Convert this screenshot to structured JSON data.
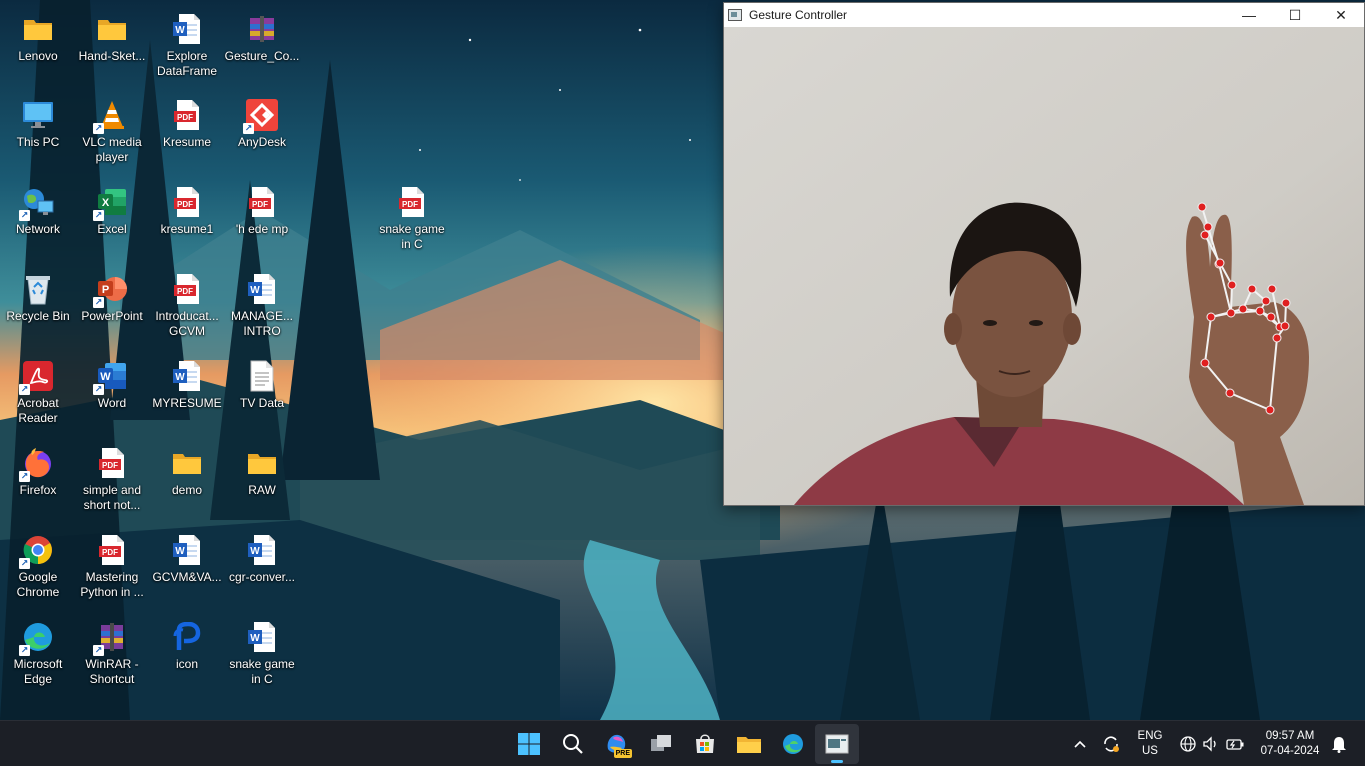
{
  "desktop_icons": [
    {
      "label": "Lenovo",
      "icon": "folder-icon"
    },
    {
      "label": "Hand-Sket...",
      "icon": "folder-icon"
    },
    {
      "label": "Explore DataFrame",
      "icon": "word-doc-icon"
    },
    {
      "label": "Gesture_Co...",
      "icon": "winrar-archive-icon"
    },
    {
      "label": "This PC",
      "icon": "monitor-icon"
    },
    {
      "label": "VLC media player",
      "icon": "vlc-icon"
    },
    {
      "label": "Kresume",
      "icon": "pdf-icon"
    },
    {
      "label": "AnyDesk",
      "icon": "anydesk-icon"
    },
    {
      "label": "Network",
      "icon": "network-icon"
    },
    {
      "label": "Excel",
      "icon": "excel-icon"
    },
    {
      "label": "kresume1",
      "icon": "pdf-icon"
    },
    {
      "label": "'h ede mp",
      "icon": "pdf-icon"
    },
    {
      "label": "snake game in C",
      "icon": "pdf-icon"
    },
    {
      "label": "Recycle Bin",
      "icon": "recycle-bin-icon"
    },
    {
      "label": "PowerPoint",
      "icon": "powerpoint-icon"
    },
    {
      "label": "Introducat... GCVM",
      "icon": "pdf-icon"
    },
    {
      "label": "MANAGE... INTRO",
      "icon": "word-doc-icon"
    },
    {
      "label": "Acrobat Reader",
      "icon": "acrobat-icon"
    },
    {
      "label": "Word",
      "icon": "word-app-icon"
    },
    {
      "label": "MYRESUME",
      "icon": "word-doc-icon"
    },
    {
      "label": "TV Data",
      "icon": "text-file-icon"
    },
    {
      "label": "Firefox",
      "icon": "firefox-icon"
    },
    {
      "label": "simple and short not...",
      "icon": "pdf-icon"
    },
    {
      "label": "demo",
      "icon": "folder-icon"
    },
    {
      "label": "RAW",
      "icon": "folder-icon"
    },
    {
      "label": "Google Chrome",
      "icon": "chrome-icon"
    },
    {
      "label": "Mastering Python in ...",
      "icon": "pdf-icon"
    },
    {
      "label": "GCVM&VA...",
      "icon": "word-doc-icon"
    },
    {
      "label": "cgr-conver...",
      "icon": "word-doc-icon"
    },
    {
      "label": "Microsoft Edge",
      "icon": "edge-icon"
    },
    {
      "label": "WinRAR - Shortcut",
      "icon": "winrar-icon"
    },
    {
      "label": "icon",
      "icon": "p-logo-icon"
    },
    {
      "label": "snake game in C",
      "icon": "word-doc-icon"
    }
  ],
  "window": {
    "title": "Gesture Controller",
    "minimize_glyph": "—",
    "maximize_glyph": "☐",
    "close_glyph": "✕",
    "icons": [
      "window-app-icon",
      "minimize-icon",
      "maximize-icon",
      "close-icon"
    ]
  },
  "taskbar": {
    "apps": [
      "start-icon",
      "search-icon",
      "copilot-icon",
      "task-view-icon",
      "store-icon",
      "file-explorer-icon",
      "edge-icon",
      "gesture-controller-taskbar-icon"
    ],
    "copilot_badge": "PRE",
    "language_line1": "ENG",
    "language_line2": "US",
    "time": "09:57 AM",
    "date": "07-04-2024",
    "tray_icons": [
      "chevron-up-icon",
      "sync-icon",
      "globe-icon",
      "volume-icon",
      "battery-icon",
      "notification-bell-icon"
    ]
  },
  "colors": {
    "taskbar_bg": "#1c1f26",
    "accent": "#4cc2ff",
    "landmark": "#e02020"
  }
}
